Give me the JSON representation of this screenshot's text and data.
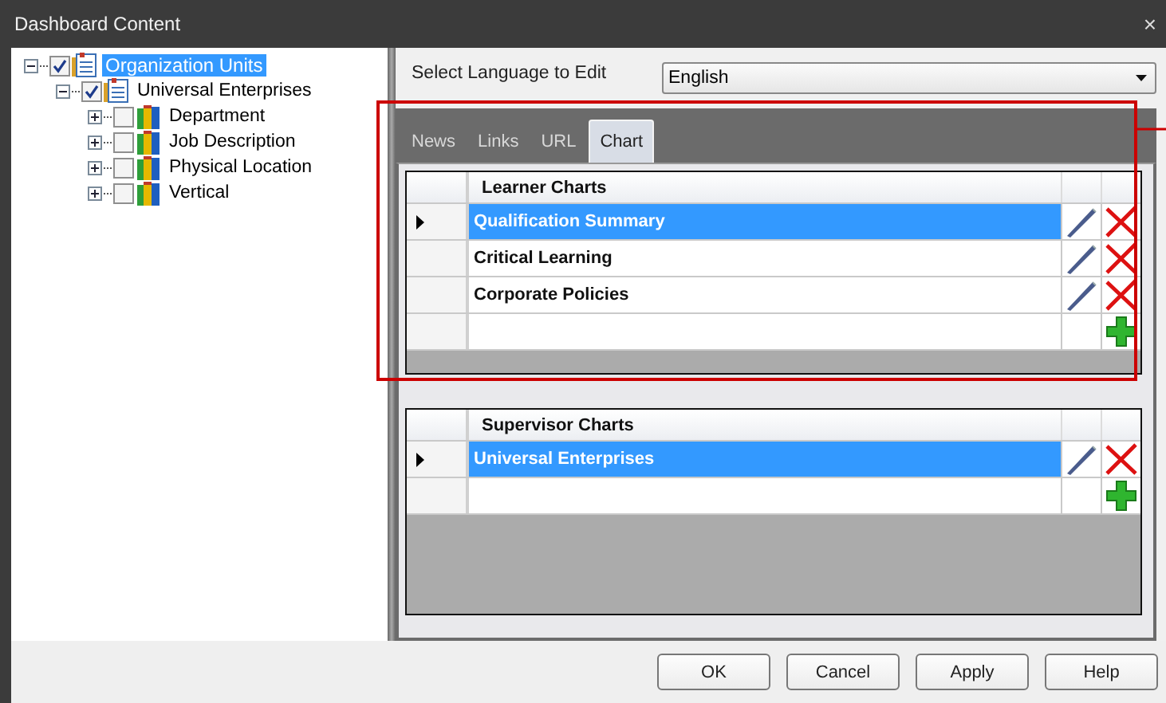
{
  "window": {
    "title": "Dashboard Content",
    "close": "×"
  },
  "tree": [
    {
      "label": "Organization Units",
      "kind": "unit",
      "checked": true,
      "expanded": true,
      "selected": true,
      "children": [
        {
          "label": "Universal Enterprises",
          "kind": "unit",
          "checked": true,
          "expanded": true,
          "selected": false,
          "children": [
            {
              "label": "Department",
              "kind": "category",
              "checked": false,
              "expanded": false,
              "selected": false
            },
            {
              "label": "Job Description",
              "kind": "category",
              "checked": false,
              "expanded": false,
              "selected": false
            },
            {
              "label": "Physical Location",
              "kind": "category",
              "checked": false,
              "expanded": false,
              "selected": false
            },
            {
              "label": "Vertical",
              "kind": "category",
              "checked": false,
              "expanded": false,
              "selected": false
            }
          ]
        }
      ]
    }
  ],
  "language": {
    "label": "Select Language to Edit",
    "value": "English"
  },
  "tabs": [
    {
      "label": "News",
      "selected": false
    },
    {
      "label": "Links",
      "selected": false
    },
    {
      "label": "URL",
      "selected": false
    },
    {
      "label": "Chart",
      "selected": true
    }
  ],
  "grids": [
    {
      "title": "Learner Charts",
      "rows": [
        {
          "name": "Qualification Summary",
          "selected": true
        },
        {
          "name": "Critical Learning",
          "selected": false
        },
        {
          "name": "Corporate Policies",
          "selected": false
        }
      ]
    },
    {
      "title": "Supervisor Charts",
      "rows": [
        {
          "name": "Universal Enterprises",
          "selected": true
        }
      ]
    }
  ],
  "buttons": [
    "OK",
    "Cancel",
    "Apply",
    "Help"
  ]
}
